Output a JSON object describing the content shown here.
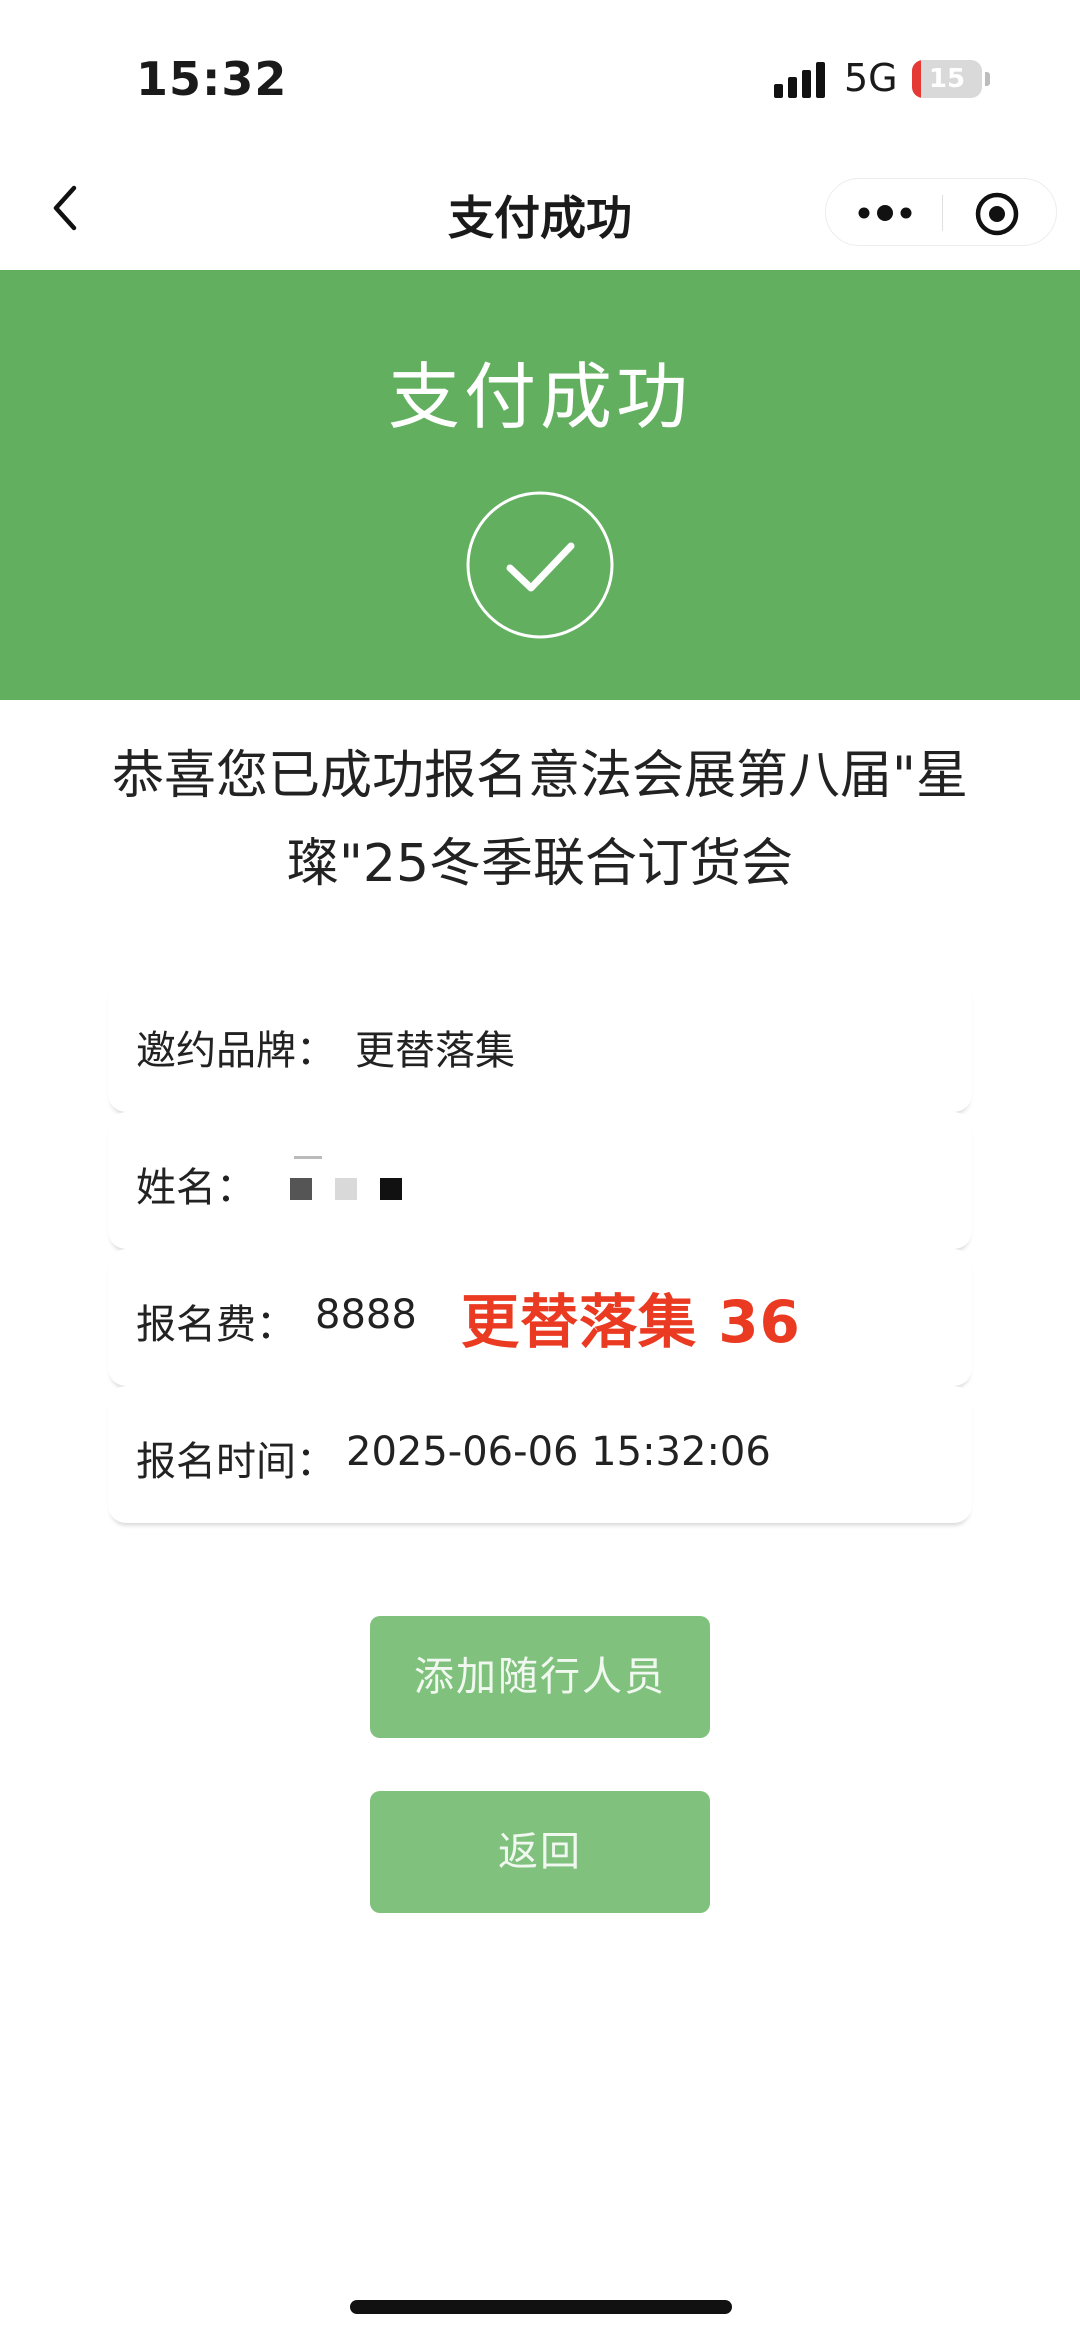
{
  "status_bar": {
    "time": "15:32",
    "network": "5G",
    "battery_level": "15",
    "battery_color": "#e53935",
    "icons": [
      "signal-icon",
      "battery-icon"
    ]
  },
  "nav_bar": {
    "title": "支付成功",
    "icons": [
      "back-arrow-icon",
      "more-dots-icon",
      "close-target-icon"
    ]
  },
  "banner": {
    "title": "支付成功",
    "background_color": "#63af60",
    "icon": "check-circle-icon"
  },
  "message": {
    "line1": "恭喜您已成功报名意法会展第八届\"星",
    "line2": "璨\"25冬季联合订货会"
  },
  "info": {
    "brand_label": "邀约品牌：",
    "brand_value": "更替落集",
    "name_label": "姓名：",
    "fee_label": "报名费：",
    "fee_value": "8888",
    "overlay_text": "更替落集 36",
    "time_label": "报名时间：",
    "time_value": "2025-06-06 15:32:06"
  },
  "buttons": {
    "add_companion": "添加随行人员",
    "back": "返回",
    "color": "#80c17e"
  }
}
